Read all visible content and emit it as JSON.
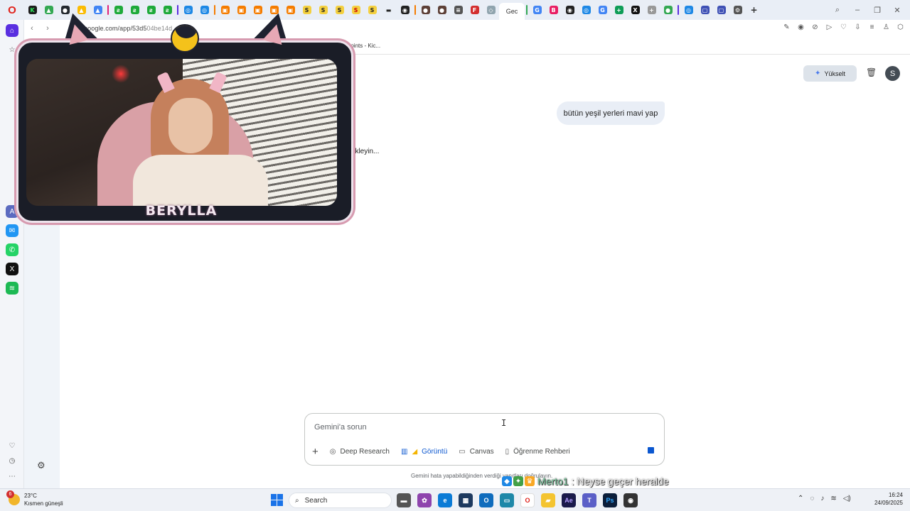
{
  "browser": {
    "logo": "O",
    "active_tab_label": "Gec",
    "url_host": "google.com/app/53d5",
    "url_rest": "0",
    "url_tail": "4be",
    "url_end": "14d",
    "bookmark_label": "Points - Kic..."
  },
  "window_controls": [
    "search-icon",
    "minimize",
    "restore",
    "close"
  ],
  "gemini": {
    "upgrade_label": "Yükselt",
    "avatar_letter": "S",
    "user_message": "bütün yeşil yerleri mavi yap",
    "waiting_text": "e bekleyin...",
    "prompt_placeholder": "Gemini'a sorun",
    "tools": {
      "deep_research": "Deep Research",
      "image": "Görüntü",
      "canvas": "Canvas",
      "learning": "Öğrenme Rehberi"
    },
    "disclaimer": "Gemini hata yapabildiğinden verdiği yanıtları doğrulayın."
  },
  "overlay": {
    "streamer_name": "BERYLLA",
    "chat_user": "Merto1",
    "chat_message": ": Neyse geçer heralde"
  },
  "taskbar": {
    "weather_badge": "6",
    "temperature": "23°C",
    "weather_desc": "Kısmen güneşli",
    "search_label": "Search",
    "time": "16:24",
    "date": "24/09/2025"
  },
  "colors": {
    "accent_blue": "#0b57d0",
    "opera_red": "#e0211a",
    "chat_user": "#7ec9a1"
  }
}
